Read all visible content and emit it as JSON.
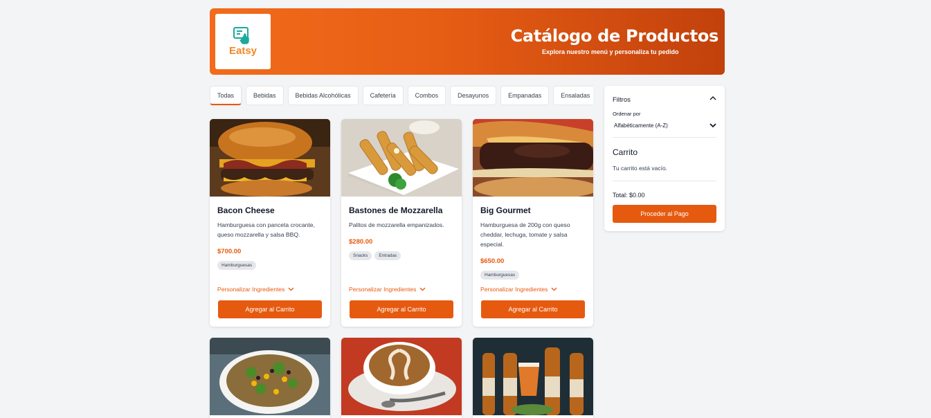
{
  "header": {
    "logo_text": "Eatsy",
    "title": "Catálogo de Productos",
    "subtitle": "Explora nuestro menú y personaliza tu pedido"
  },
  "tabs": [
    "Todas",
    "Bebidas",
    "Bebidas Alcohólicas",
    "Cafetería",
    "Combos",
    "Desayunos",
    "Empanadas",
    "Ensaladas"
  ],
  "products": [
    {
      "name": "Bacon Cheese",
      "description": "Hamburguesa con panceta crocante, queso mozzarella y salsa BBQ.",
      "price": "$700.00",
      "tags": [
        "Hamburguesas"
      ],
      "customize": "Personalizar Ingredientes",
      "add": "Agregar al Carrito"
    },
    {
      "name": "Bastones de Mozzarella",
      "description": "Palitos de mozzarella empanizados.",
      "price": "$280.00",
      "tags": [
        "Snacks",
        "Entradas"
      ],
      "customize": "Personalizar Ingredientes",
      "add": "Agregar al Carrito"
    },
    {
      "name": "Big Gourmet",
      "description": "Hamburguesa de 200g con queso cheddar, lechuga, tomate y salsa especial.",
      "price": "$650.00",
      "tags": [
        "Hamburguesas"
      ],
      "customize": "Personalizar Ingredientes",
      "add": "Agregar al Carrito"
    }
  ],
  "sidebar": {
    "filters_title": "Filtros",
    "sort_label": "Ordenar por",
    "sort_value": "Alfabéticamente (A-Z)",
    "cart_title": "Carrito",
    "cart_empty": "Tu carrito está vacío.",
    "total": "Total: $0.00",
    "pay_button": "Proceder al Pago"
  },
  "colors": {
    "accent": "#e65a10",
    "header_start": "#f26c1b",
    "header_end": "#c2410c"
  },
  "icons": [
    "touch-screen-icon",
    "chevron-up-icon",
    "chevron-down-icon"
  ]
}
